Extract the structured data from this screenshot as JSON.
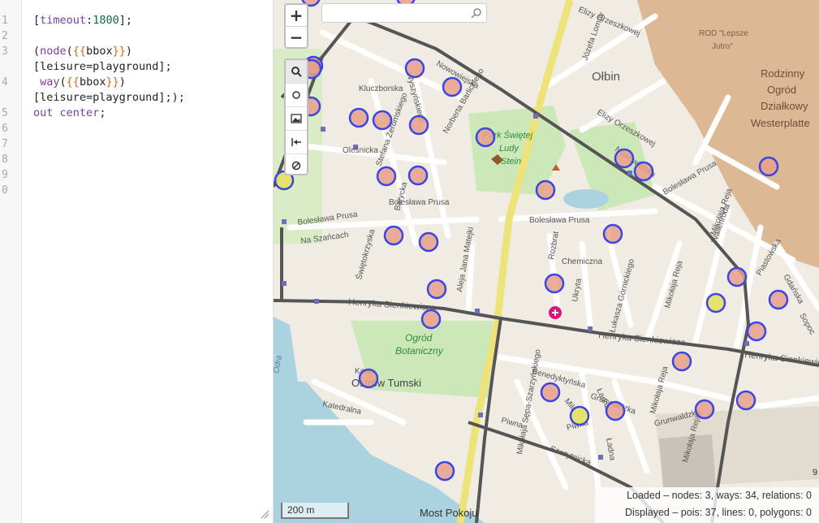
{
  "editor": {
    "line_numbers": [
      "1",
      "2",
      "3",
      "",
      "4",
      "",
      "5",
      "6",
      "7",
      "8",
      "9",
      "0"
    ],
    "line1": {
      "open": "[",
      "key": "timeout",
      "colon": ":",
      "value": "1800",
      "close": "];"
    },
    "line3": {
      "open": "(",
      "kw": "node",
      "p1": "(",
      "tpl": "{{",
      "word": "bbox",
      "tpl2": "}}",
      "p2": ")"
    },
    "line3b": "[leisure=playground];",
    "line4": {
      "kw": "way",
      "p1": "(",
      "tpl": "{{",
      "word": "bbox",
      "tpl2": "}}",
      "p2": ")"
    },
    "line4b": "[leisure=playground];);",
    "line5": {
      "kw": "out",
      "sp": " ",
      "kw2": "center",
      "end": ";"
    }
  },
  "map": {
    "controls": {
      "zoom_in": "+",
      "zoom_out": "−"
    },
    "tools": [
      "search-icon",
      "circle-icon",
      "image-icon",
      "arrow-left-bar-icon",
      "no-entry-icon"
    ],
    "search": {
      "value": "",
      "placeholder": ""
    },
    "scale_label": "200 m",
    "stats": {
      "loaded": "Loaded – nodes: 3, ways: 34, relations: 0",
      "displayed": "Displayed – pois: 37, lines: 0, polygons: 0"
    },
    "labels": {
      "olbin": "Ołbin",
      "rod": "ROD \"Lepsze",
      "rod2": "Jutro\"",
      "rodzinny1": "Rodzinny",
      "rodzinny2": "Ogród",
      "rodzinny3": "Działkowy",
      "rodzinny4": "Westerplatte",
      "park1": "Park Świętej",
      "park2": "Ludy",
      "park3": "Stein",
      "ogrod1": "Ogród",
      "ogrod2": "Botaniczny",
      "ostrow": "Ostrów Tumski",
      "most": "Most Pokoju",
      "nowowiejska": "Nowowiejska",
      "nowowiejska2": "Nowowiejska",
      "prusa": "Bolesława Prusa",
      "prusa2": "Bolesława Prusa",
      "prusa3": "Bolesława Prusa",
      "prusa4": "Bolesława Prusa",
      "sienk": "Henryka Sienkiewicza",
      "sienk2": "Henryka Sienkiewicza",
      "sienk3": "Henryka Sienkiewicza",
      "kluczborska": "Kluczborska",
      "olesnicka": "Oleśnicka",
      "szancach": "Na Szańcach",
      "chemiczna": "Chemiczna",
      "grunwaldzka": "Grunwaldzka",
      "grunwaldzka2": "Grunwaldzka",
      "szczytnicka": "Szczytnicka",
      "katedralna": "Katedralna",
      "piwna": "Piwna",
      "piwna2": "Piwna",
      "benedyktynska": "Benedyktyńska",
      "orzeszkowej": "Elizy Orzeszkowej",
      "orzeszkowej2": "Elizy Orzeszkowej",
      "zeromskiego": "Stefana Żeromskiego",
      "barycka": "Barycka",
      "matejki": "Aleja Jana Matejki",
      "swietokrzyska": "Świętokrzyska",
      "rozbrat": "Rozbrat",
      "ukryta": "Ukryta",
      "gornickiego": "Łukasza Górnickiego",
      "reja": "Mikołaja Reja",
      "reja2": "Mikołaja Reja",
      "reja3": "Mikołaja Reja",
      "reja4": "Mikołaja Reja",
      "piastowska": "Piastowska",
      "wallenroda": "Wallenroda",
      "gdanska": "Gdańska",
      "sopocka": "Sopoc",
      "mila": "Miła",
      "ladna": "Ładna",
      "ladna2": "Ładna",
      "szarzynskiego": "Mikołaja Sępa-Szarzyńskiego",
      "kanal": "Kana",
      "odra": "Odra",
      "lompy": "Józefa Lompy",
      "nolbrecht": "Norberta Barlickiego",
      "wyszynskiego": "Wyszyńskiego",
      "num9": "9"
    },
    "colors": {
      "playground_stroke": "#3a45e6",
      "playground_fill_selected": "#e6e060",
      "main_road": "#5a5a5a",
      "railway": "#f2e88c",
      "water": "#aad3df",
      "park": "#c8e6b4",
      "allotment": "#dbb896"
    }
  }
}
